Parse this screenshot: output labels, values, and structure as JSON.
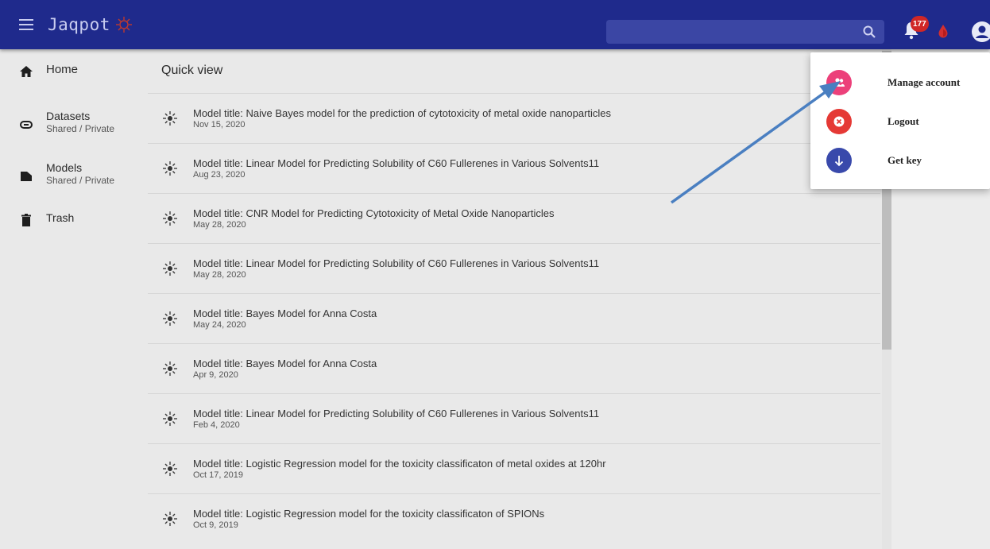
{
  "header": {
    "brand": "Jaqpot",
    "notification_count": "177",
    "icons": [
      "hamburger-icon",
      "logo-icon",
      "search-icon",
      "bell-icon",
      "drop-icon",
      "account-icon"
    ]
  },
  "sidebar": {
    "items": [
      {
        "label": "Home",
        "sub": "",
        "icon": "home-icon"
      },
      {
        "label": "Datasets",
        "sub": "Shared / Private",
        "icon": "paperclip-icon"
      },
      {
        "label": "Models",
        "sub": "Shared / Private",
        "icon": "folder-icon"
      },
      {
        "label": "Trash",
        "sub": "",
        "icon": "trash-icon"
      }
    ]
  },
  "main": {
    "title": "Quick view",
    "models": [
      {
        "title": "Model title: Naive Bayes model for the prediction of cytotoxicity of metal oxide nanoparticles",
        "date": "Nov 15, 2020"
      },
      {
        "title": "Model title: Linear Model for Predicting Solubility of C60 Fullerenes in Various Solvents11",
        "date": "Aug 23, 2020"
      },
      {
        "title": "Model title: CNR Model for Predicting Cytotoxicity of Metal Oxide Nanoparticles",
        "date": "May 28, 2020"
      },
      {
        "title": "Model title: Linear Model for Predicting Solubility of C60 Fullerenes in Various Solvents11",
        "date": "May 28, 2020"
      },
      {
        "title": "Model title: Bayes Model for Anna Costa",
        "date": "May 24, 2020"
      },
      {
        "title": "Model title: Bayes Model for Anna Costa",
        "date": "Apr 9, 2020"
      },
      {
        "title": "Model title: Linear Model for Predicting Solubility of C60 Fullerenes in Various Solvents11",
        "date": "Feb 4, 2020"
      },
      {
        "title": "Model title: Logistic Regression model for the toxicity classificaton of metal oxides at 120hr",
        "date": "Oct 17, 2019"
      },
      {
        "title": "Model title: Logistic Regression model for the toxicity classificaton of SPIONs",
        "date": "Oct 9, 2019"
      }
    ]
  },
  "account_menu": {
    "items": [
      {
        "label": "Manage account",
        "icon": "people-icon",
        "color": "#ec407a"
      },
      {
        "label": "Logout",
        "icon": "close-circle-icon",
        "color": "#e53935"
      },
      {
        "label": "Get key",
        "icon": "arrow-down-icon",
        "color": "#3949ab"
      }
    ]
  },
  "colors": {
    "topbar": "#1f2a8c",
    "annotation_arrow": "#4a7fc1",
    "badge": "#d02727"
  }
}
